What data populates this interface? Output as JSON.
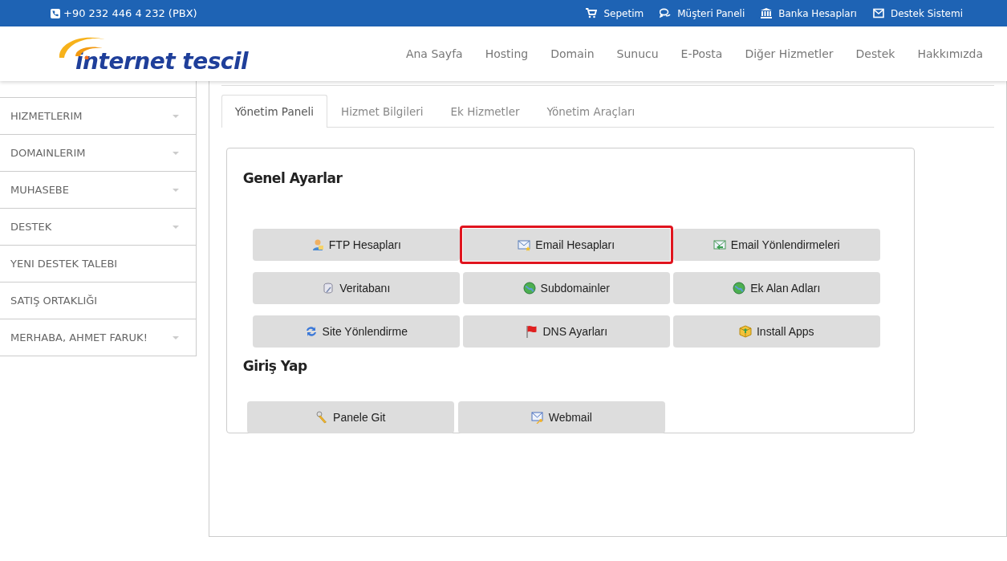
{
  "top_bar": {
    "phone": "+90 232 446 4 232 (PBX)",
    "links": [
      {
        "label": "Sepetim"
      },
      {
        "label": "Müşteri Paneli"
      },
      {
        "label": "Banka Hesapları"
      },
      {
        "label": "Destek Sistemi"
      }
    ]
  },
  "header": {
    "logo": "internet tescil",
    "nav": [
      {
        "label": "Ana Sayfa"
      },
      {
        "label": "Hosting"
      },
      {
        "label": "Domain"
      },
      {
        "label": "Sunucu"
      },
      {
        "label": "E-Posta"
      },
      {
        "label": "Diğer Hizmetler"
      },
      {
        "label": "Destek"
      },
      {
        "label": "Hakkımızda"
      }
    ]
  },
  "sidebar": {
    "items": [
      {
        "label": "HIZMETLERIM",
        "has_dropdown": true
      },
      {
        "label": "DOMAINLERIM",
        "has_dropdown": true
      },
      {
        "label": "MUHASEBE",
        "has_dropdown": true
      },
      {
        "label": "DESTEK",
        "has_dropdown": true
      },
      {
        "label": "YENI DESTEK TALEBI",
        "has_dropdown": false
      },
      {
        "label": "SATIŞ ORTAKLIĞI",
        "has_dropdown": false
      },
      {
        "label": "MERHABA, AHMET FARUK!",
        "has_dropdown": true
      }
    ]
  },
  "tabs": [
    {
      "label": "Yönetim Paneli",
      "selected": true
    },
    {
      "label": "Hizmet Bilgileri",
      "selected": false
    },
    {
      "label": "Ek Hizmetler",
      "selected": false
    },
    {
      "label": "Yönetim Araçları",
      "selected": false
    }
  ],
  "sections": [
    {
      "title": "Genel Ayarlar",
      "buttons": [
        {
          "label": "FTP Hesapları",
          "highlighted": false
        },
        {
          "label": "Email Hesapları",
          "highlighted": true
        },
        {
          "label": "Email Yönlendirmeleri",
          "highlighted": false
        },
        {
          "label": "Veritabanı",
          "highlighted": false
        },
        {
          "label": "Subdomainler",
          "highlighted": false
        },
        {
          "label": "Ek Alan Adları",
          "highlighted": false
        },
        {
          "label": "Site Yönlendirme",
          "highlighted": false
        },
        {
          "label": "DNS Ayarları",
          "highlighted": false
        },
        {
          "label": "Install Apps",
          "highlighted": false
        }
      ]
    },
    {
      "title": "Giriş Yap",
      "buttons": [
        {
          "label": "Panele Git",
          "highlighted": false
        },
        {
          "label": "Webmail",
          "highlighted": false
        }
      ]
    }
  ]
}
